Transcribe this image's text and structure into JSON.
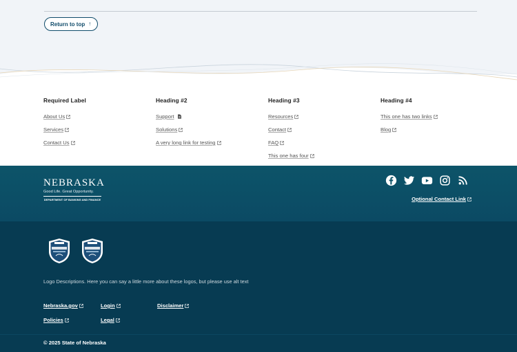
{
  "return_button": {
    "label": "Return to top"
  },
  "columns": [
    {
      "heading": "Required Label",
      "links": [
        {
          "label": "About Us",
          "icon": "external-link-icon"
        },
        {
          "label": "Services",
          "icon": "external-link-icon"
        },
        {
          "label": "Contact Us",
          "icon": "external-link-icon"
        }
      ]
    },
    {
      "heading": "Heading #2",
      "links": [
        {
          "label": "Support",
          "icon": "document-icon"
        },
        {
          "label": "Solutions",
          "icon": "external-link-icon"
        },
        {
          "label": "A very long link for testing",
          "icon": "external-link-icon"
        }
      ]
    },
    {
      "heading": "Heading #3",
      "links": [
        {
          "label": "Resources",
          "icon": "external-link-icon"
        },
        {
          "label": "Contact",
          "icon": "external-link-icon"
        },
        {
          "label": "FAQ",
          "icon": "external-link-icon"
        },
        {
          "label": "This one has four",
          "icon": "external-link-icon"
        }
      ]
    },
    {
      "heading": "Heading #4",
      "links": [
        {
          "label": "This one has two links",
          "icon": "external-link-icon"
        },
        {
          "label": "Blog",
          "icon": "external-link-icon"
        }
      ]
    }
  ],
  "brand": {
    "logo_word": "NEBRASKA",
    "tagline": "Good Life. Great Opportunity.",
    "department": "DEPARTMENT OF BANKING AND FINANCE"
  },
  "social": [
    {
      "name": "facebook-icon"
    },
    {
      "name": "twitter-icon"
    },
    {
      "name": "youtube-icon"
    },
    {
      "name": "instagram-icon"
    },
    {
      "name": "rss-icon"
    }
  ],
  "optional_contact_link": "Optional Contact Link",
  "badges": [
    {
      "name": "accreditation-badge-1"
    },
    {
      "name": "accreditation-badge-2"
    }
  ],
  "logo_description": "Logo Descriptions. Here you can say a little more about these logos, but please use alt text",
  "bottom_links": [
    {
      "label": "Nebraska.gov"
    },
    {
      "label": "Login"
    },
    {
      "label": "Disclaimer"
    },
    {
      "label": "Policies"
    },
    {
      "label": "Legal"
    }
  ],
  "copyright": "© 2025 State of Nebraska",
  "colors": {
    "primary": "#0f4b6a",
    "brand_band": "#0d5469",
    "footer_bg": "#073b52",
    "page_bg": "#f1f4f8"
  }
}
